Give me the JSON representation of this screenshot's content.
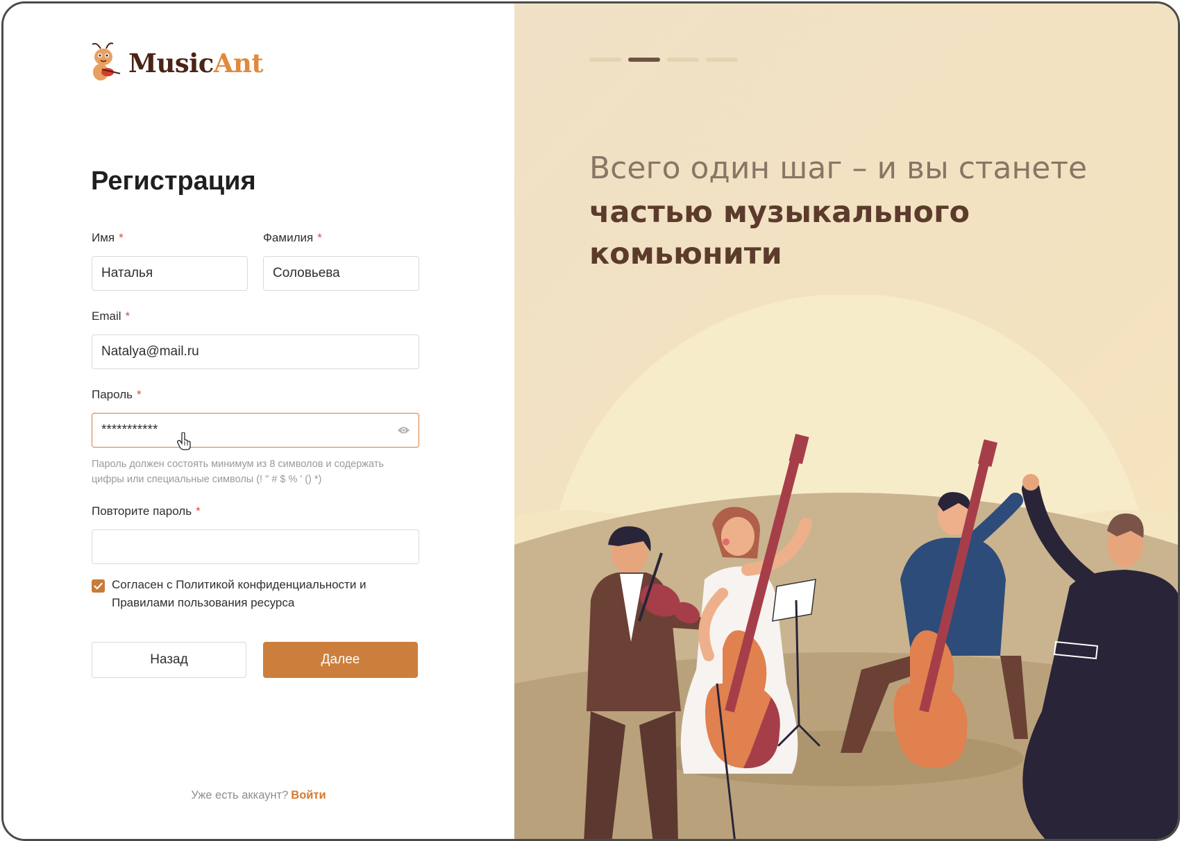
{
  "brand": {
    "name_part1": "Music",
    "name_part2": "Ant"
  },
  "form": {
    "title": "Регистрация",
    "first_name": {
      "label": "Имя",
      "value": "Наталья"
    },
    "last_name": {
      "label": "Фамилия",
      "value": "Соловьева"
    },
    "email": {
      "label": "Email",
      "value": "Natalya@mail.ru"
    },
    "password": {
      "label": "Пароль",
      "value": "***********",
      "hint": "Пароль должен состоять минимум из 8 символов и содержать цифры или специальные символы (! \" # $ % ' () *)"
    },
    "password_repeat": {
      "label": "Повторите пароль",
      "value": ""
    },
    "required_mark": "*",
    "consent": {
      "checked": true,
      "text": "Согласен с Политикой конфиденциальности и Правилами пользования ресурса"
    },
    "back_label": "Назад",
    "next_label": "Далее"
  },
  "footer": {
    "question": "Уже есть аккаунт?",
    "login_label": "Войти"
  },
  "promo": {
    "line1": "Всего один шаг – и вы станете",
    "line2": "частью музыкального комьюнити",
    "carousel_total": 4,
    "carousel_active": 2
  },
  "icons": {
    "eye": "eye-icon",
    "cursor": "hand-cursor-icon",
    "check": "check-icon",
    "logo": "ant-mascot-icon"
  },
  "colors": {
    "accent": "#cc7f3d",
    "link": "#d8782c",
    "required": "#e2483e",
    "headline_dark": "#5c3b2d",
    "panel_bg": "#f0e1c6"
  }
}
